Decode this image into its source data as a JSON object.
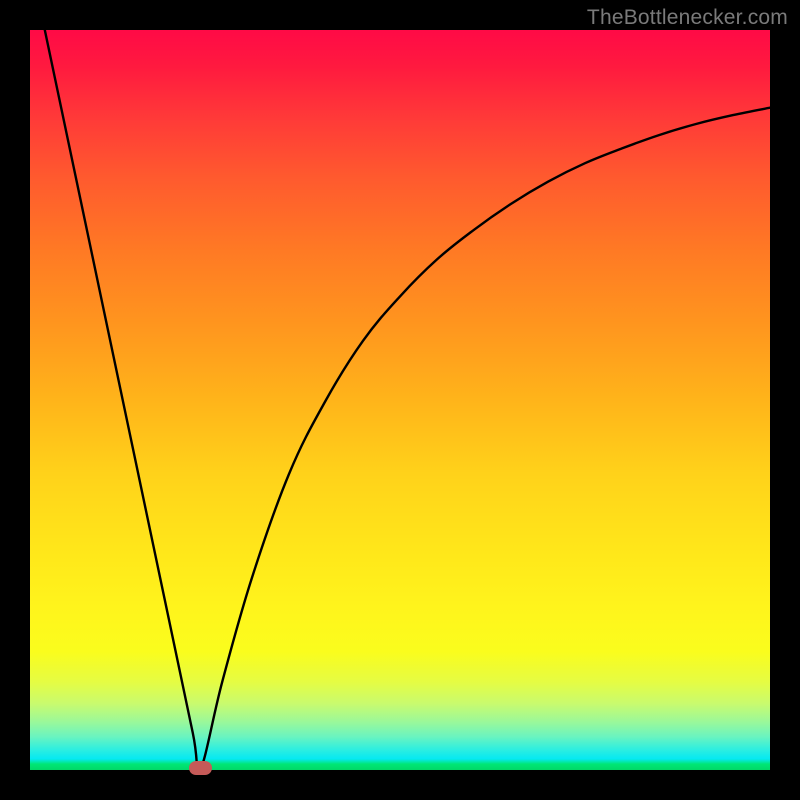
{
  "watermark": {
    "text": "TheBottlenecker.com"
  },
  "colors": {
    "frame": "#000000",
    "curve": "#000000",
    "marker": "#c55a58",
    "gradient_top": "#ff0a46",
    "gradient_bottom": "#00d967"
  },
  "chart_data": {
    "type": "line",
    "title": "",
    "xlabel": "",
    "ylabel": "",
    "xlim": [
      0,
      100
    ],
    "ylim": [
      0,
      100
    ],
    "x_min_at": 23,
    "marker": {
      "x": 23,
      "y": 0
    },
    "annotations": [
      "TheBottlenecker.com"
    ],
    "series": [
      {
        "name": "left-branch",
        "x": [
          2,
          6,
          10,
          14,
          18,
          22,
          23
        ],
        "values": [
          100,
          81,
          62,
          43,
          24,
          5,
          0
        ]
      },
      {
        "name": "right-branch",
        "x": [
          23,
          26,
          30,
          35,
          40,
          45,
          50,
          55,
          60,
          65,
          70,
          75,
          80,
          85,
          90,
          95,
          100
        ],
        "values": [
          0,
          12,
          26,
          40,
          50,
          58,
          64,
          69,
          73,
          76.5,
          79.5,
          82,
          84,
          85.8,
          87.3,
          88.5,
          89.5
        ]
      }
    ]
  }
}
